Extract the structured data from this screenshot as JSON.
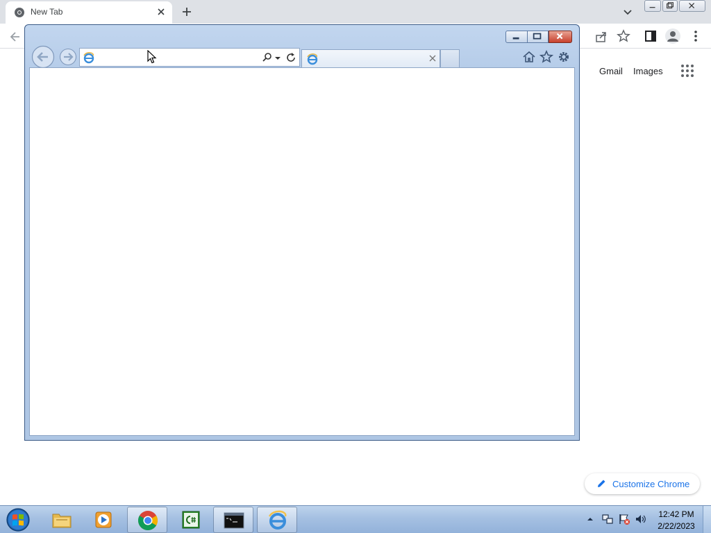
{
  "chrome": {
    "tab_title": "New Tab",
    "gmail_label": "Gmail",
    "images_label": "Images",
    "customize_label": "Customize Chrome"
  },
  "ie": {
    "address_value": "",
    "tab_title": ""
  },
  "taskbar": {
    "items": [
      {
        "name": "windows-explorer",
        "icon": "folder-icon"
      },
      {
        "name": "media-player",
        "icon": "media-player-icon"
      },
      {
        "name": "google-chrome",
        "icon": "chrome-icon",
        "active": true
      },
      {
        "name": "csharp-editor",
        "icon": "csharp-icon"
      },
      {
        "name": "command-prompt",
        "icon": "cmd-icon",
        "active": true
      },
      {
        "name": "internet-explorer",
        "icon": "ie-icon",
        "active": true
      }
    ],
    "clock_time": "12:42 PM",
    "clock_date": "2/22/2023"
  },
  "colors": {
    "chrome_tabstrip": "#dee1e6",
    "chrome_accent": "#1a73e8",
    "ie_frame": "#b4cbe8",
    "taskbar": "#a5c0e2",
    "ie_close": "#c8412d"
  }
}
